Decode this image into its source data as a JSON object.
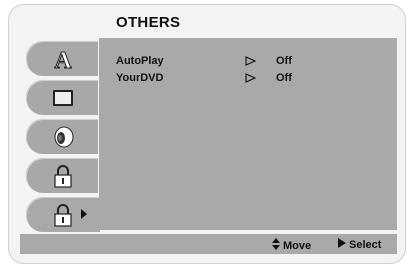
{
  "title": "OTHERS",
  "sidebar": {
    "tabs": [
      {
        "icon": "letter-a-icon"
      },
      {
        "icon": "tv-screen-icon"
      },
      {
        "icon": "speaker-icon"
      },
      {
        "icon": "lock-icon"
      },
      {
        "icon": "lock-icon",
        "selected": true
      }
    ]
  },
  "settings": [
    {
      "label": "AutoPlay",
      "value": "Off"
    },
    {
      "label": "YourDVD",
      "value": "Off"
    }
  ],
  "footer": {
    "move_label": "Move",
    "select_label": "Select"
  },
  "colors": {
    "panel": "#a9a9a9",
    "background": "#f3f3f3",
    "text": "#111111"
  }
}
